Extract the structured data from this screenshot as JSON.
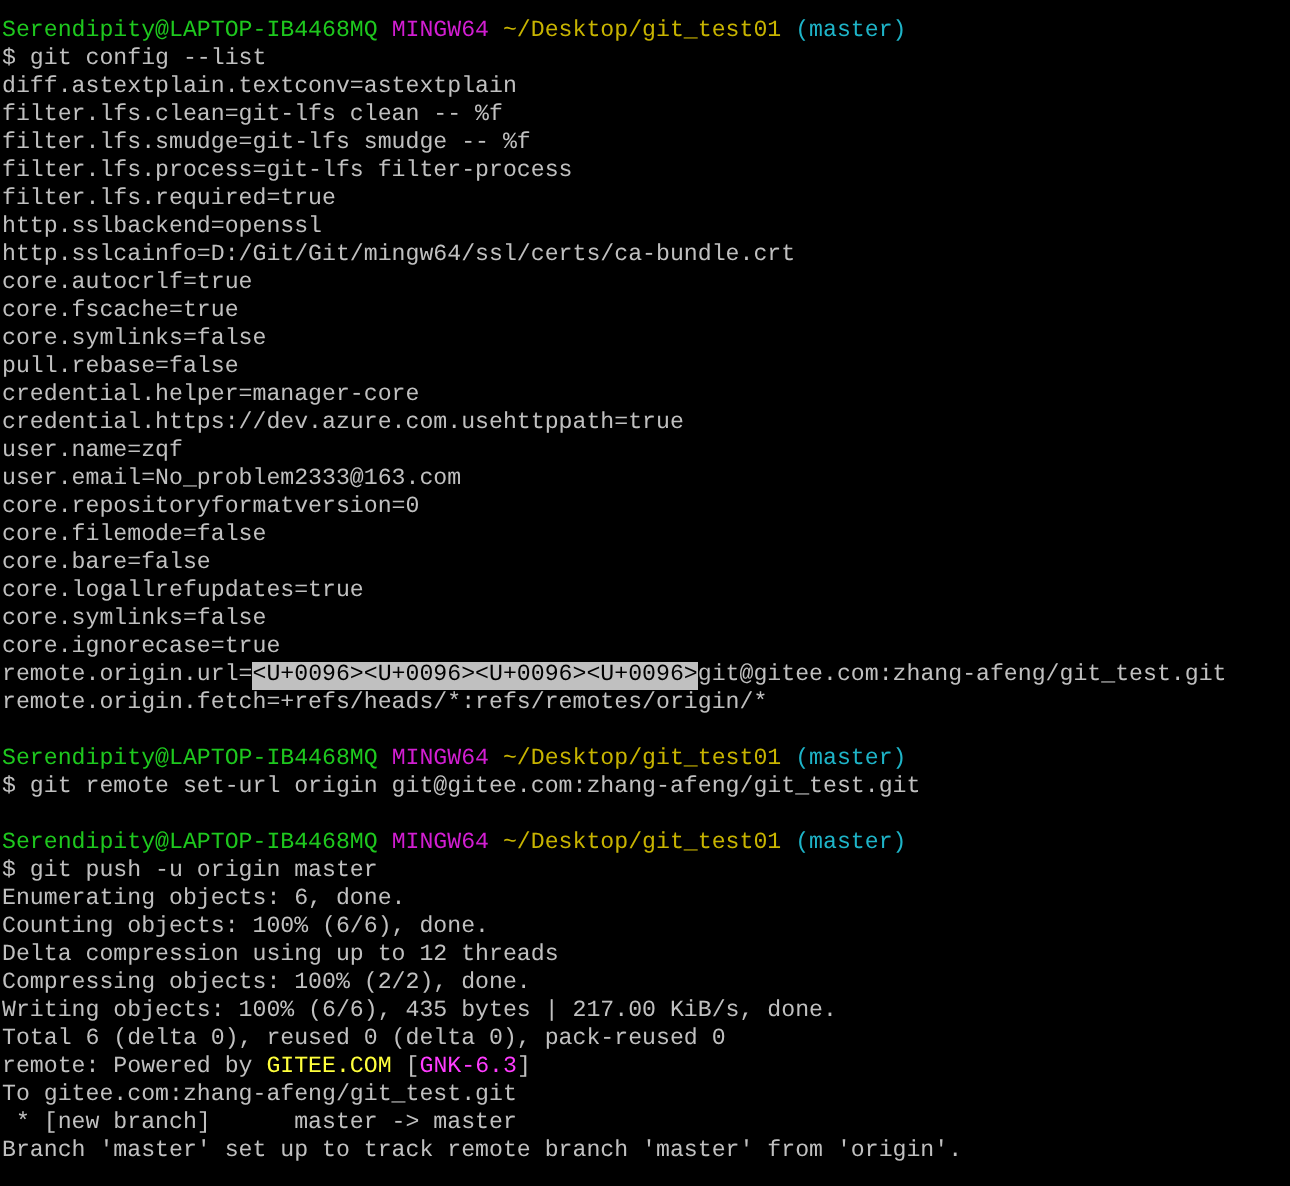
{
  "lines": [
    {
      "kind": "prompt",
      "user": "Serendipity@LAPTOP-IB4468MQ",
      "system": "MINGW64",
      "path": "~/Desktop/git_test01",
      "branch": "(master)"
    },
    {
      "kind": "command",
      "text": "$ git config --list"
    },
    {
      "kind": "output",
      "text": "diff.astextplain.textconv=astextplain"
    },
    {
      "kind": "output",
      "text": "filter.lfs.clean=git-lfs clean -- %f"
    },
    {
      "kind": "output",
      "text": "filter.lfs.smudge=git-lfs smudge -- %f"
    },
    {
      "kind": "output",
      "text": "filter.lfs.process=git-lfs filter-process"
    },
    {
      "kind": "output",
      "text": "filter.lfs.required=true"
    },
    {
      "kind": "output",
      "text": "http.sslbackend=openssl"
    },
    {
      "kind": "output",
      "text": "http.sslcainfo=D:/Git/Git/mingw64/ssl/certs/ca-bundle.crt"
    },
    {
      "kind": "output",
      "text": "core.autocrlf=true"
    },
    {
      "kind": "output",
      "text": "core.fscache=true"
    },
    {
      "kind": "output",
      "text": "core.symlinks=false"
    },
    {
      "kind": "output",
      "text": "pull.rebase=false"
    },
    {
      "kind": "output",
      "text": "credential.helper=manager-core"
    },
    {
      "kind": "output",
      "text": "credential.https://dev.azure.com.usehttppath=true"
    },
    {
      "kind": "output",
      "text": "user.name=zqf"
    },
    {
      "kind": "output",
      "text": "user.email=No_problem2333@163.com"
    },
    {
      "kind": "output",
      "text": "core.repositoryformatversion=0"
    },
    {
      "kind": "output",
      "text": "core.filemode=false"
    },
    {
      "kind": "output",
      "text": "core.bare=false"
    },
    {
      "kind": "output",
      "text": "core.logallrefupdates=true"
    },
    {
      "kind": "output",
      "text": "core.symlinks=false"
    },
    {
      "kind": "output",
      "text": "core.ignorecase=true"
    },
    {
      "kind": "mixed",
      "segments": [
        {
          "kind": "plain",
          "text": "remote.origin.url="
        },
        {
          "kind": "highlight",
          "text": "<U+0096><U+0096><U+0096><U+0096>"
        },
        {
          "kind": "plain",
          "text": "git@gitee.com:zhang-afeng/git_test.git"
        }
      ]
    },
    {
      "kind": "output",
      "text": "remote.origin.fetch=+refs/heads/*:refs/remotes/origin/*"
    },
    {
      "kind": "blank"
    },
    {
      "kind": "prompt",
      "user": "Serendipity@LAPTOP-IB4468MQ",
      "system": "MINGW64",
      "path": "~/Desktop/git_test01",
      "branch": "(master)"
    },
    {
      "kind": "command",
      "text": "$ git remote set-url origin git@gitee.com:zhang-afeng/git_test.git"
    },
    {
      "kind": "blank"
    },
    {
      "kind": "prompt",
      "user": "Serendipity@LAPTOP-IB4468MQ",
      "system": "MINGW64",
      "path": "~/Desktop/git_test01",
      "branch": "(master)"
    },
    {
      "kind": "command",
      "text": "$ git push -u origin master"
    },
    {
      "kind": "output",
      "text": "Enumerating objects: 6, done."
    },
    {
      "kind": "output",
      "text": "Counting objects: 100% (6/6), done."
    },
    {
      "kind": "output",
      "text": "Delta compression using up to 12 threads"
    },
    {
      "kind": "output",
      "text": "Compressing objects: 100% (2/2), done."
    },
    {
      "kind": "output",
      "text": "Writing objects: 100% (6/6), 435 bytes | 217.00 KiB/s, done."
    },
    {
      "kind": "output",
      "text": "Total 6 (delta 0), reused 0 (delta 0), pack-reused 0"
    },
    {
      "kind": "mixed",
      "segments": [
        {
          "kind": "plain",
          "text": "remote: Powered by"
        },
        {
          "kind": "brand",
          "text": "GITEE.COM"
        },
        {
          "kind": "plain",
          "text": "["
        },
        {
          "kind": "tag",
          "text": "GNK-6.3"
        },
        {
          "kind": "plain",
          "text": "]"
        }
      ]
    },
    {
      "kind": "output",
      "text": "To gitee.com:zhang-afeng/git_test.git"
    },
    {
      "kind": "output",
      "text": " * [new branch]      master -> master"
    },
    {
      "kind": "output",
      "text": "Branch 'master' set up to track remote branch 'master' from 'origin'."
    }
  ]
}
